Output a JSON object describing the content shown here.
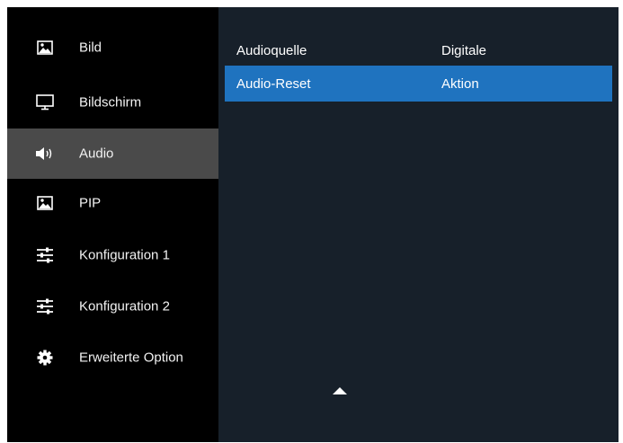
{
  "sidebar": {
    "items": [
      {
        "label": "Bild",
        "icon": "picture-icon",
        "selected": false
      },
      {
        "label": "Bildschirm",
        "icon": "monitor-icon",
        "selected": false
      },
      {
        "label": "Audio",
        "icon": "speaker-icon",
        "selected": true
      },
      {
        "label": "PIP",
        "icon": "picture-icon",
        "selected": false
      },
      {
        "label": "Konfiguration 1",
        "icon": "sliders-icon",
        "selected": false
      },
      {
        "label": "Konfiguration 2",
        "icon": "sliders-icon",
        "selected": false
      },
      {
        "label": "Erweiterte Option",
        "icon": "gear-icon",
        "selected": false
      }
    ]
  },
  "content": {
    "rows": [
      {
        "label": "Audioquelle",
        "value": "Digitale",
        "highlighted": false
      },
      {
        "label": "Audio-Reset",
        "value": "Aktion",
        "highlighted": true
      }
    ],
    "scroll_indicator": "scroll-up-arrow-icon"
  },
  "colors": {
    "sidebar_bg": "#000000",
    "selected_bg": "#4a4a4a",
    "content_bg": "#17202a",
    "highlight": "#1f73bf",
    "text": "#ffffff"
  }
}
